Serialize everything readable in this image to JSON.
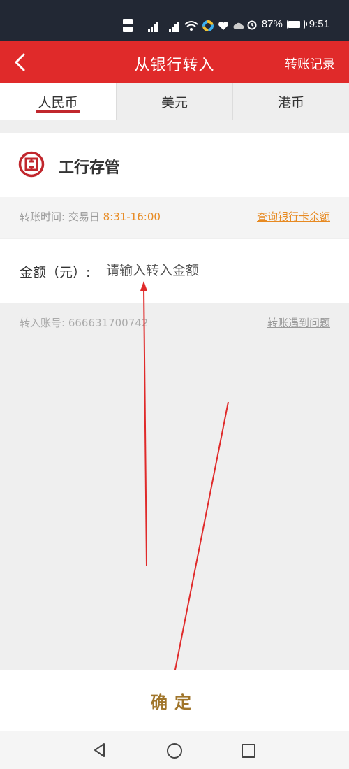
{
  "status_bar": {
    "battery": "87%",
    "time": "9:51",
    "battery_level": 0.87
  },
  "header": {
    "title": "从银行转入",
    "right_link": "转账记录"
  },
  "tabs": [
    {
      "label": "人民币",
      "active": true
    },
    {
      "label": "美元",
      "active": false
    },
    {
      "label": "港币",
      "active": false
    }
  ],
  "bank": {
    "name": "工行存管"
  },
  "transfer_time": {
    "label": "转账时间: 交易日",
    "value": "8:31-16:00",
    "balance_link": "查询银行卡余额"
  },
  "amount": {
    "label": "金额（元）:",
    "placeholder": "请输入转入金额"
  },
  "account": {
    "text": "转入账号: 666631700742",
    "problem_link": "转账遇到问题"
  },
  "confirm_button": "确定",
  "colors": {
    "header_red": "#e02a2a",
    "accent_orange": "#e78a22",
    "confirm_gold": "#a0752a"
  }
}
